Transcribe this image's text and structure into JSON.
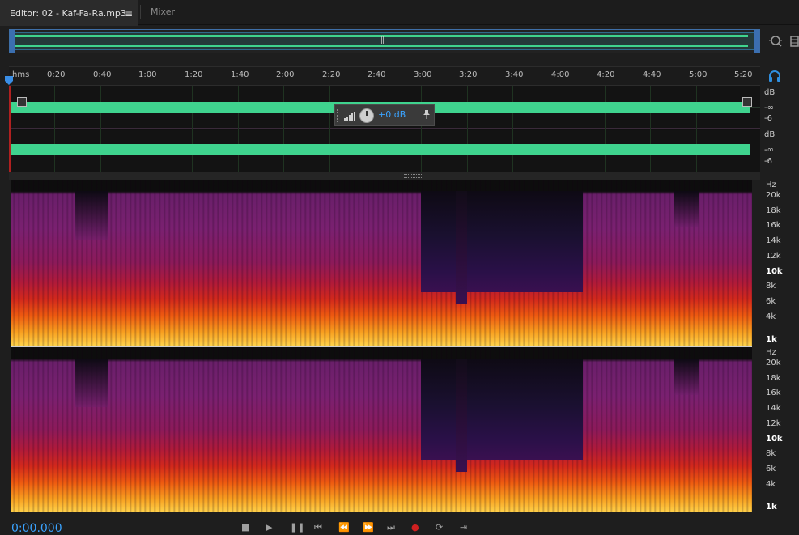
{
  "tabs": {
    "editor_label": "Editor: 02 - Kaf-Fa-Ra.mp3",
    "mixer_label": "Mixer",
    "menu_glyph": "≡"
  },
  "overview": {
    "grip_glyph": "|||"
  },
  "ruler": {
    "unit_label": "hms",
    "ticks": [
      "0:20",
      "0:40",
      "1:00",
      "1:20",
      "1:40",
      "2:00",
      "2:20",
      "2:40",
      "3:00",
      "3:20",
      "3:40",
      "4:00",
      "4:20",
      "4:40",
      "5:00",
      "5:20"
    ]
  },
  "hud": {
    "volume_value": "+0 dB"
  },
  "amplitude_scale": {
    "ch1": [
      "dB",
      "-∞",
      "-6"
    ],
    "ch2": [
      "dB",
      "-∞",
      "-6"
    ]
  },
  "frequency_scale": {
    "unit": "Hz",
    "ch1": [
      "20k",
      "18k",
      "16k",
      "14k",
      "12k",
      "10k",
      "8k",
      "6k",
      "4k",
      "1k"
    ],
    "ch2": [
      "20k",
      "18k",
      "16k",
      "14k",
      "12k",
      "10k",
      "8k",
      "6k",
      "4k",
      "1k"
    ]
  },
  "transport": {
    "time": "0:00.000"
  },
  "icons": {
    "zoom": "zoom-icon",
    "headphones": "headphones-icon",
    "pin": "pin-icon",
    "level": "level-meter-icon",
    "knob": "volume-knob-icon"
  },
  "colors": {
    "waveform": "#3fd38e",
    "accent": "#3aa3ff",
    "selection_border": "#3e6fa8"
  }
}
